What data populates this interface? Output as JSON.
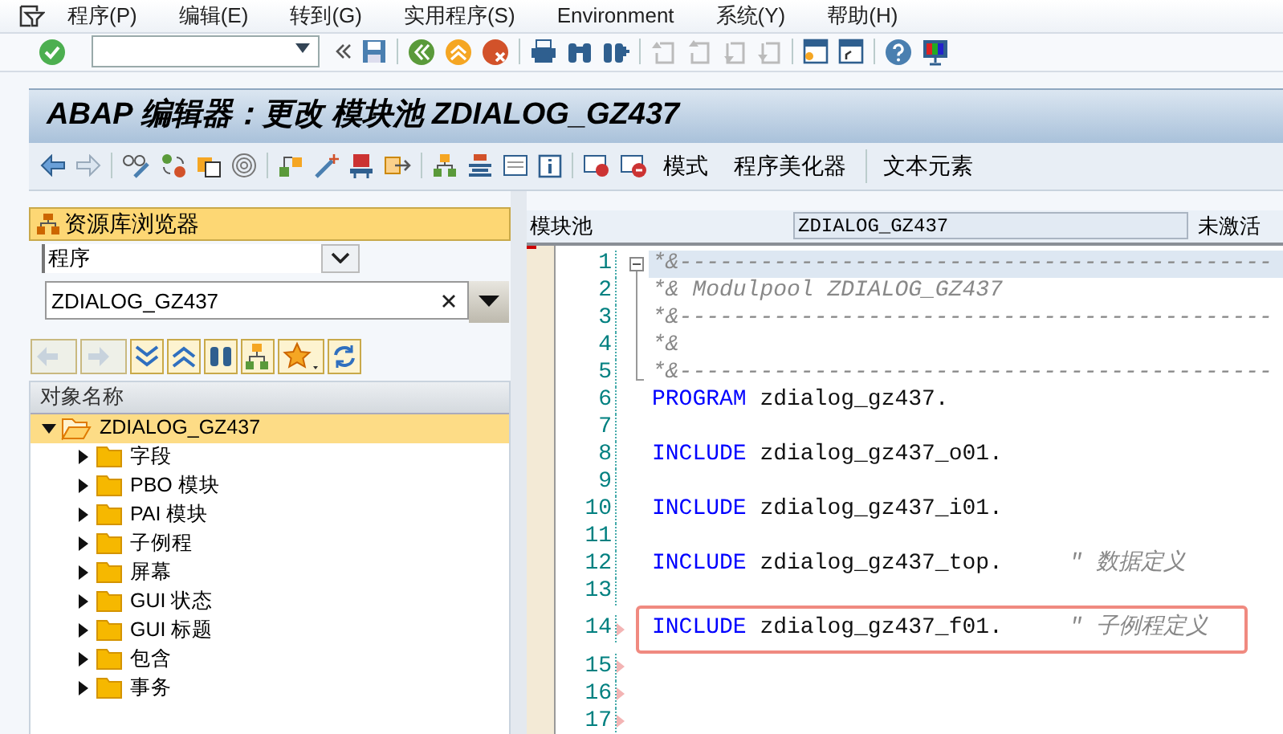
{
  "menu": [
    {
      "label": "程序(P)"
    },
    {
      "label": "编辑(E)"
    },
    {
      "label": "转到(G)"
    },
    {
      "label": "实用程序(S)"
    },
    {
      "label": "Environment"
    },
    {
      "label": "系统(Y)"
    },
    {
      "label": "帮助(H)"
    }
  ],
  "window": {
    "title": "ABAP 编辑器：更改 模块池 ZDIALOG_GZ437"
  },
  "app_toolbar": {
    "buttons": [
      {
        "label": "模式"
      },
      {
        "label": "程序美化器"
      },
      {
        "label": "文本元素"
      }
    ]
  },
  "repository_browser": {
    "title": "资源库浏览器",
    "object_type": "程序",
    "object_name": "ZDIALOG_GZ437",
    "column": "对象名称",
    "tree": [
      {
        "label": "ZDIALOG_GZ437",
        "expanded": true,
        "selected": true,
        "children": [
          {
            "label": "字段",
            "expanded": false,
            "selected": false
          },
          {
            "label": "PBO 模块",
            "expanded": false,
            "selected": false
          },
          {
            "label": "PAI 模块",
            "expanded": false,
            "selected": false
          },
          {
            "label": "子例程",
            "expanded": false,
            "selected": false
          },
          {
            "label": "屏幕",
            "expanded": false,
            "selected": false
          },
          {
            "label": "GUI 状态",
            "expanded": false,
            "selected": false
          },
          {
            "label": "GUI 标题",
            "expanded": false,
            "selected": false
          },
          {
            "label": "包含",
            "expanded": false,
            "selected": false
          },
          {
            "label": "事务",
            "expanded": false,
            "selected": false
          }
        ]
      }
    ]
  },
  "editor": {
    "type_label": "模块池",
    "program": "ZDIALOG_GZ437",
    "status": "未激活",
    "lines": [
      {
        "number": "1",
        "current": true,
        "highlighted": false,
        "marker": false,
        "fold_start": true,
        "segments": [
          {
            "kind": "comment",
            "text": "*&--------------------------------------------"
          }
        ]
      },
      {
        "number": "2",
        "current": false,
        "highlighted": false,
        "marker": false,
        "fold_start": false,
        "segments": [
          {
            "kind": "comment",
            "text": "*& Modulpool ZDIALOG_GZ437"
          }
        ]
      },
      {
        "number": "3",
        "current": false,
        "highlighted": false,
        "marker": false,
        "fold_start": false,
        "segments": [
          {
            "kind": "comment",
            "text": "*&--------------------------------------------"
          }
        ]
      },
      {
        "number": "4",
        "current": false,
        "highlighted": false,
        "marker": false,
        "fold_start": false,
        "segments": [
          {
            "kind": "comment",
            "text": "*&"
          }
        ]
      },
      {
        "number": "5",
        "current": false,
        "highlighted": false,
        "marker": false,
        "fold_start": false,
        "segments": [
          {
            "kind": "comment",
            "text": "*&--------------------------------------------"
          }
        ]
      },
      {
        "number": "6",
        "current": false,
        "highlighted": false,
        "marker": false,
        "fold_start": false,
        "segments": [
          {
            "kind": "keyword",
            "text": "PROGRAM"
          },
          {
            "kind": "plain",
            "text": "zdialog_gz437."
          }
        ]
      },
      {
        "number": "7",
        "current": false,
        "highlighted": false,
        "marker": false,
        "fold_start": false
      },
      {
        "number": "8",
        "current": false,
        "highlighted": false,
        "marker": false,
        "fold_start": false,
        "segments": [
          {
            "kind": "keyword",
            "text": "INCLUDE"
          },
          {
            "kind": "plain",
            "text": "zdialog_gz437_o01."
          }
        ]
      },
      {
        "number": "9",
        "current": false,
        "highlighted": false,
        "marker": false,
        "fold_start": false
      },
      {
        "number": "10",
        "current": false,
        "highlighted": false,
        "marker": false,
        "fold_start": false,
        "segments": [
          {
            "kind": "keyword",
            "text": "INCLUDE"
          },
          {
            "kind": "plain",
            "text": "zdialog_gz437_i01."
          }
        ]
      },
      {
        "number": "11",
        "current": false,
        "highlighted": false,
        "marker": false,
        "fold_start": false
      },
      {
        "number": "12",
        "current": false,
        "highlighted": false,
        "marker": false,
        "fold_start": false,
        "segments": [
          {
            "kind": "keyword",
            "text": "INCLUDE"
          },
          {
            "kind": "plain",
            "text": "zdialog_gz437_top."
          },
          {
            "kind": "comment",
            "text": "\" 数据定义"
          }
        ]
      },
      {
        "number": "13",
        "current": false,
        "highlighted": false,
        "marker": false,
        "fold_start": false
      },
      {
        "number": "14",
        "current": false,
        "highlighted": true,
        "marker": true,
        "fold_start": false,
        "segments": [
          {
            "kind": "keyword",
            "text": "INCLUDE"
          },
          {
            "kind": "plain",
            "text": "zdialog_gz437_f01."
          },
          {
            "kind": "comment",
            "text": "\" 子例程定义"
          }
        ]
      },
      {
        "number": "15",
        "current": false,
        "highlighted": false,
        "marker": true,
        "fold_start": false
      },
      {
        "number": "16",
        "current": false,
        "highlighted": false,
        "marker": true,
        "fold_start": false
      },
      {
        "number": "17",
        "current": false,
        "highlighted": false,
        "marker": true,
        "fold_start": false
      }
    ]
  }
}
